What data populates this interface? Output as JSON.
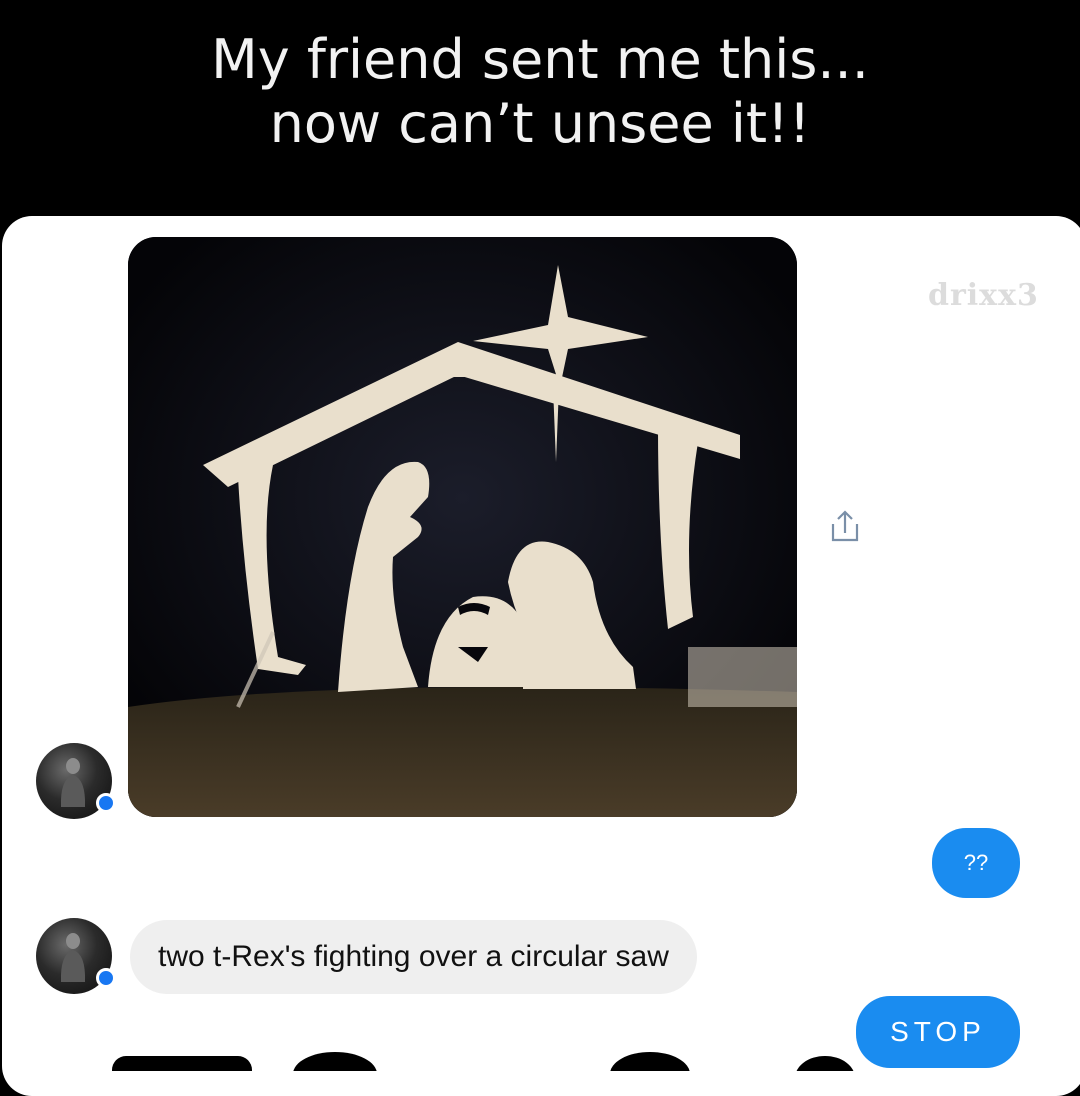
{
  "caption": {
    "line1": "My friend sent me this...",
    "line2": "now can’t unsee it!!"
  },
  "watermark": "drixx3",
  "messages": {
    "received_text": "two t-Rex's fighting over a circular saw",
    "sent_1": "??",
    "sent_2": "STOP"
  },
  "colors": {
    "sent_bubble": "#1a8cf0",
    "received_bubble": "#efefef",
    "badge": "#1877f2"
  },
  "icons": {
    "share": "share-icon",
    "badge": "messenger-badge-icon"
  }
}
